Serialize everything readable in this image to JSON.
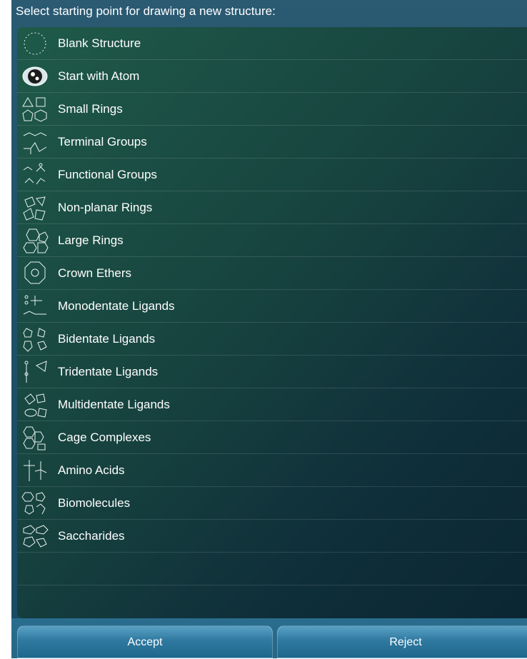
{
  "header": {
    "title": "Select starting point for drawing a new structure:"
  },
  "rows": [
    {
      "label": "Blank Structure",
      "icon": "blank-structure-icon"
    },
    {
      "label": "Start with Atom",
      "icon": "atom-icon"
    },
    {
      "label": "Small Rings",
      "icon": "small-rings-icon"
    },
    {
      "label": "Terminal Groups",
      "icon": "terminal-groups-icon"
    },
    {
      "label": "Functional Groups",
      "icon": "functional-groups-icon"
    },
    {
      "label": "Non-planar Rings",
      "icon": "non-planar-rings-icon"
    },
    {
      "label": "Large Rings",
      "icon": "large-rings-icon"
    },
    {
      "label": "Crown Ethers",
      "icon": "crown-ethers-icon"
    },
    {
      "label": "Monodentate Ligands",
      "icon": "monodentate-ligands-icon"
    },
    {
      "label": "Bidentate Ligands",
      "icon": "bidentate-ligands-icon"
    },
    {
      "label": "Tridentate Ligands",
      "icon": "tridentate-ligands-icon"
    },
    {
      "label": "Multidentate Ligands",
      "icon": "multidentate-ligands-icon"
    },
    {
      "label": "Cage Complexes",
      "icon": "cage-complexes-icon"
    },
    {
      "label": "Amino Acids",
      "icon": "amino-acids-icon"
    },
    {
      "label": "Biomolecules",
      "icon": "biomolecules-icon"
    },
    {
      "label": "Saccharides",
      "icon": "saccharides-icon"
    }
  ],
  "buttons": {
    "accept": "Accept",
    "reject": "Reject"
  },
  "colors": {
    "accent": "#2f7aa1",
    "list_bg": "#17433f"
  }
}
